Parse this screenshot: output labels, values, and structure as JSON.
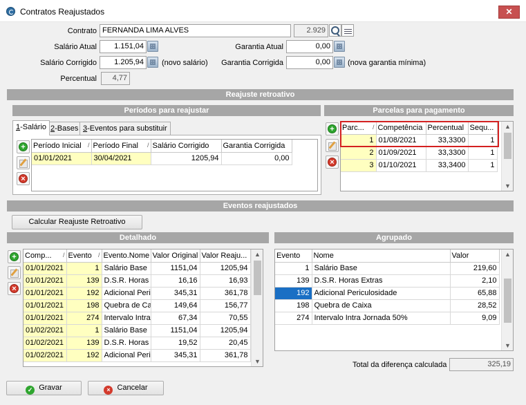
{
  "window": {
    "title": "Contratos Reajustados",
    "close": "✕"
  },
  "form": {
    "contrato_label": "Contrato",
    "contrato_name": "FERNANDA LIMA ALVES",
    "contrato_code": "2.929",
    "salario_atual_label": "Salário Atual",
    "salario_atual": "1.151,04",
    "garantia_atual_label": "Garantia Atual",
    "garantia_atual": "0,00",
    "salario_corrigido_label": "Salário Corrigido",
    "salario_corrigido": "1.205,94",
    "novo_salario_note": "(novo salário)",
    "garantia_corrigida_label": "Garantia Corrigida",
    "garantia_corrigida": "0,00",
    "nova_garantia_note": "(nova garantia mínima)",
    "percentual_label": "Percentual",
    "percentual": "4,77"
  },
  "sections": {
    "reajuste_retroativo": "Reajuste retroativo",
    "periodos": "Períodos para reajustar",
    "parcelas": "Parcelas para pagamento",
    "eventos_reajustados": "Eventos reajustados",
    "detalhado": "Detalhado",
    "agrupado": "Agrupado"
  },
  "tabs": [
    {
      "key": "1",
      "rest": "-Salário"
    },
    {
      "key": "2",
      "rest": "-Bases"
    },
    {
      "key": "3",
      "rest": "-Eventos para substituir"
    }
  ],
  "periodos_table": {
    "headers": [
      "Período Inicial",
      "Período Final",
      "Salário Corrigido",
      "Garantia Corrigida"
    ],
    "rows": [
      [
        "01/01/2021",
        "30/04/2021",
        "1205,94",
        "0,00"
      ]
    ]
  },
  "parcelas_table": {
    "headers": [
      "Parc...",
      "Competência",
      "Percentual",
      "Sequ..."
    ],
    "rows": [
      [
        "1",
        "01/08/2021",
        "33,3300",
        "1"
      ],
      [
        "2",
        "01/09/2021",
        "33,3300",
        "1"
      ],
      [
        "3",
        "01/10/2021",
        "33,3400",
        "1"
      ]
    ]
  },
  "calc_button": "Calcular Reajuste Retroativo",
  "detalhado_table": {
    "headers": [
      "Comp...",
      "Evento",
      "Evento.Nome",
      "Valor Original",
      "Valor Reaju..."
    ],
    "rows": [
      [
        "01/01/2021",
        "1",
        "Salário Base",
        "1151,04",
        "1205,94"
      ],
      [
        "01/01/2021",
        "139",
        "D.S.R. Horas E",
        "16,16",
        "16,93"
      ],
      [
        "01/01/2021",
        "192",
        "Adicional Peric",
        "345,31",
        "361,78"
      ],
      [
        "01/01/2021",
        "198",
        "Quebra de Caix",
        "149,64",
        "156,77"
      ],
      [
        "01/01/2021",
        "274",
        "Intervalo Intra",
        "67,34",
        "70,55"
      ],
      [
        "01/02/2021",
        "1",
        "Salário Base",
        "1151,04",
        "1205,94"
      ],
      [
        "01/02/2021",
        "139",
        "D.S.R. Horas E",
        "19,52",
        "20,45"
      ],
      [
        "01/02/2021",
        "192",
        "Adicional Peric",
        "345,31",
        "361,78"
      ]
    ]
  },
  "agrupado_table": {
    "headers": [
      "Evento",
      "Nome",
      "Valor"
    ],
    "rows": [
      [
        "1",
        "Salário Base",
        "219,60"
      ],
      [
        "139",
        "D.S.R. Horas Extras",
        "2,10"
      ],
      [
        "192",
        "Adicional Periculosidade",
        "65,88"
      ],
      [
        "198",
        "Quebra de Caixa",
        "28,52"
      ],
      [
        "274",
        "Intervalo Intra Jornada 50%",
        "9,09"
      ]
    ]
  },
  "total": {
    "label": "Total da diferença calculada",
    "value": "325,19"
  },
  "buttons": {
    "gravar": "Gravar",
    "cancelar": "Cancelar"
  }
}
